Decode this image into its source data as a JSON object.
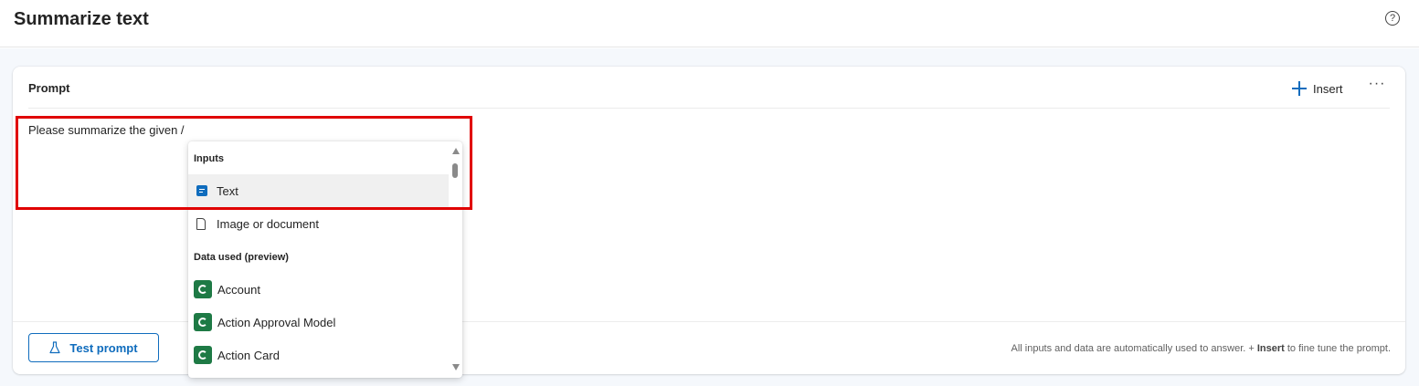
{
  "header": {
    "title": "Summarize text",
    "help_icon": "question-circle-icon",
    "help_glyph": "?"
  },
  "prompt_card": {
    "label": "Prompt",
    "insert_label": "Insert",
    "more_glyph": "···",
    "editor_text": "Please summarize the given /"
  },
  "dropdown": {
    "sections": [
      {
        "title": "Inputs",
        "items": [
          {
            "label": "Text",
            "icon": "text-input-icon",
            "selected": true
          },
          {
            "label": "Image or document",
            "icon": "document-icon",
            "selected": false
          }
        ]
      },
      {
        "title": "Data used (preview)",
        "items": [
          {
            "label": "Account",
            "icon": "dataverse-table-icon"
          },
          {
            "label": "Action Approval Model",
            "icon": "dataverse-table-icon"
          },
          {
            "label": "Action Card",
            "icon": "dataverse-table-icon"
          }
        ]
      }
    ]
  },
  "footer": {
    "test_button_label": "Test prompt",
    "note_prefix": "All inputs and data are automatically used to answer. + ",
    "note_bold": "Insert",
    "note_suffix": " to fine tune the prompt."
  },
  "colors": {
    "accent": "#0f6cbd",
    "highlight": "#e00000",
    "dataverse_green": "#1e7a45"
  }
}
